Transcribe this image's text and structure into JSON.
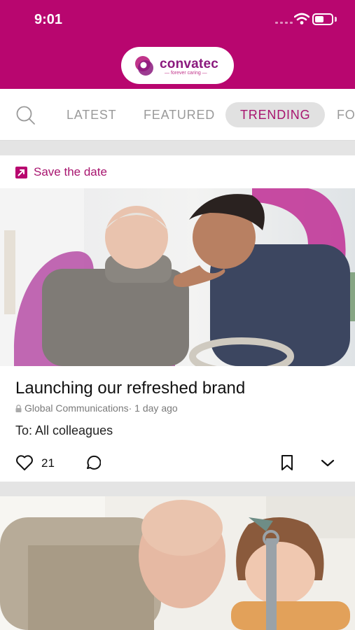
{
  "status_bar": {
    "time": "9:01"
  },
  "brand": {
    "name": "convatec",
    "tagline": "— forever caring —",
    "color": "#b8066f"
  },
  "tabs": {
    "items": [
      "LATEST",
      "FEATURED",
      "TRENDING",
      "FO"
    ],
    "active": "TRENDING"
  },
  "post": {
    "tag": "Save the date",
    "title": "Launching our refreshed brand",
    "source": "Global Communications",
    "time": " · 1 day ago",
    "audience": "To: All colleagues",
    "likes": "21"
  },
  "icons": [
    "search-icon",
    "external-link-icon",
    "heart-icon",
    "comment-icon",
    "bookmark-icon",
    "chevron-down-icon",
    "lock-icon",
    "wifi-icon",
    "battery-icon"
  ]
}
